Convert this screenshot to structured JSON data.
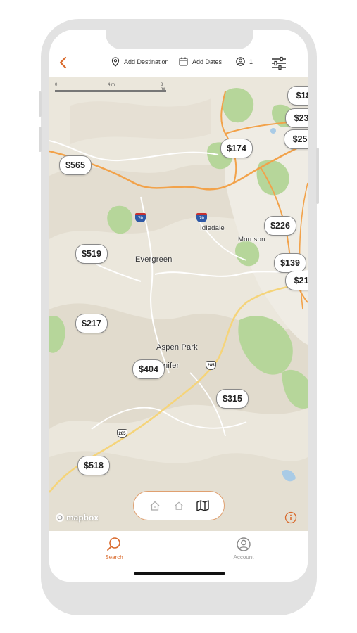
{
  "colors": {
    "accent": "#d9692b",
    "text_dark": "#222222",
    "muted": "#999999",
    "map_land": "#ebe7dc",
    "park_green": "#b6d69a",
    "road_orange": "#f2a24a",
    "road_yellow": "#f5d47a",
    "interstate_blue": "#2f59a6"
  },
  "header": {
    "back_icon": "chevron-left-icon",
    "destination": {
      "icon": "map-pin-icon",
      "label": "Add Destination"
    },
    "dates": {
      "icon": "calendar-icon",
      "label": "Add Dates"
    },
    "guests": {
      "icon": "user-circle-icon",
      "count": "1"
    },
    "filter_icon": "sliders-icon"
  },
  "map": {
    "scale": {
      "labels": [
        "0",
        "4 mi",
        "8 mi"
      ]
    },
    "places": {
      "evergreen": "Evergreen",
      "idledale": "Idledale",
      "morrison": "Morrison",
      "aspen_park": "Aspen Park",
      "conifer": "nifer"
    },
    "shields": {
      "i70_a": "70",
      "i70_b": "70",
      "us285_a": "285",
      "us285_b": "285"
    },
    "prices": [
      {
        "id": "p1",
        "label": "$18"
      },
      {
        "id": "p2",
        "label": "$23"
      },
      {
        "id": "p3",
        "label": "$25"
      },
      {
        "id": "p4",
        "label": "$174"
      },
      {
        "id": "p5",
        "label": "$565"
      },
      {
        "id": "p6",
        "label": "$226"
      },
      {
        "id": "p7",
        "label": "$519"
      },
      {
        "id": "p8",
        "label": "$139"
      },
      {
        "id": "p9",
        "label": "$21"
      },
      {
        "id": "p10",
        "label": "$217"
      },
      {
        "id": "p11",
        "label": "$404"
      },
      {
        "id": "p12",
        "label": "$315"
      },
      {
        "id": "p13",
        "label": "$518"
      }
    ],
    "attribution": "mapbox",
    "info_icon": "info-icon"
  },
  "view_toggle": {
    "options": [
      "home-icon",
      "home-small-icon",
      "map-icon"
    ],
    "selected": "map-icon"
  },
  "tabs": [
    {
      "label": "Search",
      "icon": "search-icon",
      "active": true
    },
    {
      "label": "Account",
      "icon": "account-icon",
      "active": false
    }
  ]
}
